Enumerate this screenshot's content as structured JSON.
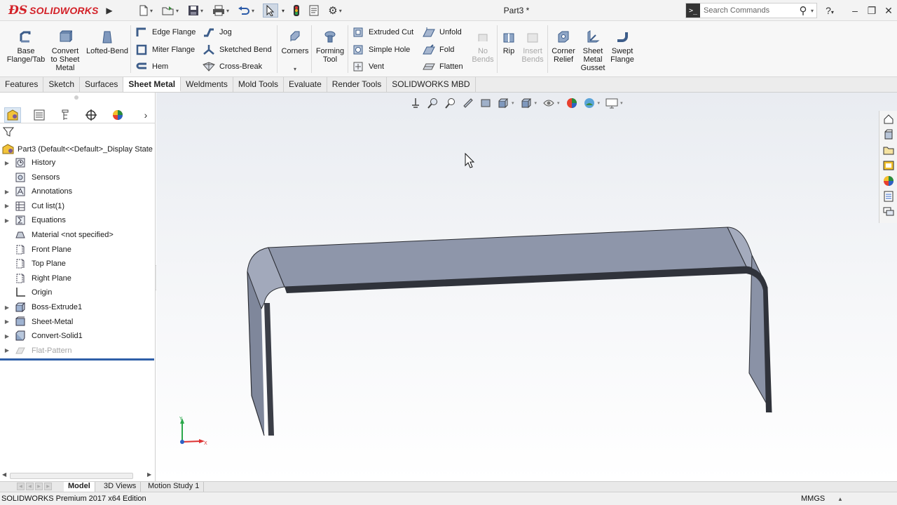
{
  "app": {
    "brand": "SOLIDWORKS",
    "doc_title": "Part3 *",
    "search_placeholder": "Search Commands",
    "help_glyph": "?",
    "min_glyph": "–",
    "restore_glyph": "❐",
    "close_glyph": "✕"
  },
  "quick_access": [
    {
      "name": "new-document-icon",
      "glyph": "🗋"
    },
    {
      "name": "open-folder-icon",
      "glyph": "📂"
    },
    {
      "name": "save-icon",
      "glyph": "💾"
    },
    {
      "name": "print-icon",
      "glyph": "🖶"
    },
    {
      "name": "undo-icon",
      "glyph": "↶"
    },
    {
      "name": "select-arrow-icon",
      "glyph": "⇱"
    },
    {
      "name": "rebuild-traffic-light-icon",
      "glyph": "⬮"
    },
    {
      "name": "file-properties-icon",
      "glyph": "▤"
    },
    {
      "name": "options-gear-icon",
      "glyph": "⚙"
    }
  ],
  "ribbon": {
    "base_flange": "Base\nFlange/Tab",
    "convert_sheet_metal": "Convert\nto Sheet\nMetal",
    "lofted_bend": "Lofted-Bend",
    "edge_flange": "Edge Flange",
    "miter_flange": "Miter Flange",
    "hem": "Hem",
    "jog": "Jog",
    "sketched_bend": "Sketched Bend",
    "cross_break": "Cross-Break",
    "corners": "Corners",
    "forming_tool": "Forming\nTool",
    "extruded_cut": "Extruded Cut",
    "simple_hole": "Simple Hole",
    "vent": "Vent",
    "unfold": "Unfold",
    "fold": "Fold",
    "flatten": "Flatten",
    "no_bends": "No\nBends",
    "rip": "Rip",
    "insert_bends": "Insert\nBends",
    "corner_relief": "Corner\nRelief",
    "sheet_metal_gusset": "Sheet\nMetal\nGusset",
    "swept_flange": "Swept\nFlange"
  },
  "tabs": [
    "Features",
    "Sketch",
    "Surfaces",
    "Sheet Metal",
    "Weldments",
    "Mold Tools",
    "Evaluate",
    "Render Tools",
    "SOLIDWORKS MBD"
  ],
  "active_tab": "Sheet Metal",
  "feature_tree": {
    "root": "Part3  (Default<<Default>_Display State",
    "items": [
      {
        "label": "History",
        "icon": "history-folder-icon",
        "expandable": true
      },
      {
        "label": "Sensors",
        "icon": "sensors-icon",
        "expandable": false
      },
      {
        "label": "Annotations",
        "icon": "annotations-icon",
        "expandable": true
      },
      {
        "label": "Cut list(1)",
        "icon": "cut-list-icon",
        "expandable": true
      },
      {
        "label": "Equations",
        "icon": "equations-icon",
        "expandable": true
      },
      {
        "label": "Material <not specified>",
        "icon": "material-icon",
        "expandable": false
      },
      {
        "label": "Front Plane",
        "icon": "plane-icon",
        "expandable": false
      },
      {
        "label": "Top Plane",
        "icon": "plane-icon",
        "expandable": false
      },
      {
        "label": "Right Plane",
        "icon": "plane-icon",
        "expandable": false
      },
      {
        "label": "Origin",
        "icon": "origin-icon",
        "expandable": false
      },
      {
        "label": "Boss-Extrude1",
        "icon": "extrude-feature-icon",
        "expandable": true
      },
      {
        "label": "Sheet-Metal",
        "icon": "sheet-metal-feature-icon",
        "expandable": true
      },
      {
        "label": "Convert-Solid1",
        "icon": "convert-solid-icon",
        "expandable": true
      },
      {
        "label": "Flat-Pattern",
        "icon": "flat-pattern-icon",
        "expandable": true,
        "suppressed": true
      }
    ]
  },
  "bottom_tabs": [
    "Model",
    "3D Views",
    "Motion Study 1"
  ],
  "active_bottom_tab": "Model",
  "status": {
    "edition": "SOLIDWORKS Premium 2017 x64 Edition",
    "units": "MMGS"
  },
  "colors": {
    "accent_red": "#d32027",
    "part_face": "#8e96aa",
    "part_face_light": "#a4abbd",
    "part_edge": "#2b2d33",
    "rollback_bar": "#2f5fa8"
  }
}
